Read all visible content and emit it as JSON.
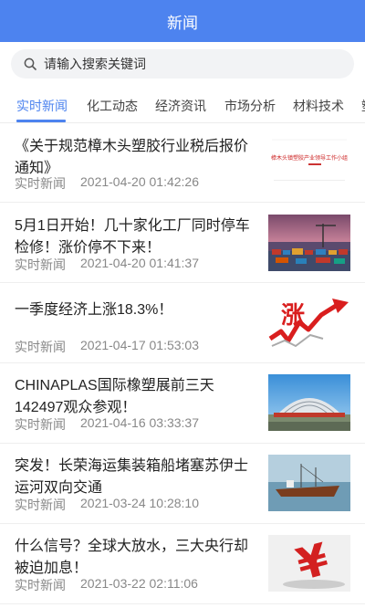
{
  "header": {
    "title": "新闻"
  },
  "search": {
    "placeholder": "请输入搜索关键词"
  },
  "tabs": [
    {
      "label": "实时新闻",
      "active": true
    },
    {
      "label": "化工动态"
    },
    {
      "label": "经济资讯"
    },
    {
      "label": "市场分析"
    },
    {
      "label": "材料技术"
    },
    {
      "label": "塑"
    }
  ],
  "news": [
    {
      "title": "《关于规范樟木头塑胶行业税后报价通知》",
      "category": "实时新闻",
      "time": "2021-04-20 01:42:26",
      "thumb": "document",
      "thumb_text": "樟木头镇塑胶产业领导工作小组办公室"
    },
    {
      "title": "5月1日开始！几十家化工厂同时停车检修！涨价停不下来！",
      "category": "实时新闻",
      "time": "2021-04-20 01:41:37",
      "thumb": "port"
    },
    {
      "title": "一季度经济上涨18.3%！",
      "category": "实时新闻",
      "time": "2021-04-17 01:53:03",
      "thumb": "rise",
      "thumb_text": "涨"
    },
    {
      "title": "CHINAPLAS国际橡塑展前三天142497观众参观！",
      "category": "实时新闻",
      "time": "2021-04-16 03:33:37",
      "thumb": "expo"
    },
    {
      "title": "突发！长荣海运集装箱船堵塞苏伊士运河双向交通",
      "category": "实时新闻",
      "time": "2021-03-24 10:28:10",
      "thumb": "ship"
    },
    {
      "title": "什么信号？全球大放水，三大央行却被迫加息！",
      "category": "实时新闻",
      "time": "2021-03-22 02:11:06",
      "thumb": "yuan",
      "thumb_text": "¥"
    }
  ]
}
